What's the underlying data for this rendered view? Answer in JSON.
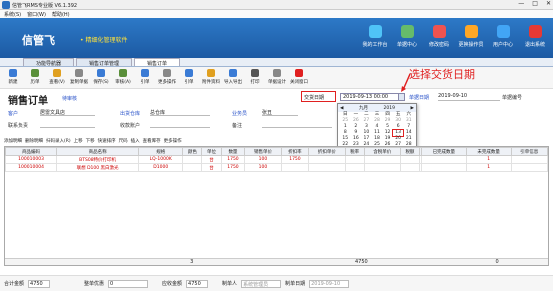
{
  "window": {
    "title": "信管飞RMS专业版 V6.1.392",
    "controls": [
      "—",
      "□",
      "✕"
    ]
  },
  "menu": [
    "系统(S)",
    "窗口(W)",
    "帮助(H)"
  ],
  "banner": {
    "logo": "信管飞",
    "slogan": "• 精细化管理软件",
    "nav": [
      "我的工作台",
      "单据中心",
      "修改密码",
      "更换操作员",
      "用户中心",
      "退出系统"
    ],
    "nav_colors": [
      "#4fc3f7",
      "#66bb6a",
      "#ef5350",
      "#ffa726",
      "#42a5f5",
      "#e53935"
    ]
  },
  "tabs": [
    "功能导航器",
    "销售订单管理",
    "销售订单"
  ],
  "toolbar": [
    "新建",
    "历单",
    "查看(V)",
    "复制单据",
    "保存(S)",
    "审核(A)",
    "引单",
    "更多操作",
    "引单",
    "附件资料",
    "导入导出",
    "打印",
    "单据设计",
    "关闭窗口"
  ],
  "form": {
    "title": "销售订单",
    "status": "待审核",
    "customer_lbl": "客户",
    "customer_val": "居雷文具店",
    "dept_lbl": "出货仓库",
    "dept_val": "总仓库",
    "sales_lbl": "业务员",
    "sales_val": "张丑",
    "contact_lbl": "联系负责",
    "receivable_lbl": "收款账户",
    "note_lbl": "备注",
    "tradedate_lbl": "交货日期",
    "date_val": "2019-09-13 00:00",
    "delivery_lbl": "单据日期",
    "delivery_val": "2019-09-10",
    "orderno_lbl": "单据编号"
  },
  "annotation": "选择交货日期",
  "calendar": {
    "month": "九月",
    "year": "2019",
    "weekdays": [
      "日",
      "一",
      "二",
      "三",
      "四",
      "五",
      "六"
    ],
    "days": [
      "25",
      "26",
      "27",
      "28",
      "29",
      "30",
      "31",
      "1",
      "2",
      "3",
      "4",
      "5",
      "6",
      "7",
      "8",
      "9",
      "10",
      "11",
      "12",
      "13",
      "14",
      "15",
      "16",
      "17",
      "18",
      "19",
      "20",
      "21",
      "22",
      "23",
      "24",
      "25",
      "26",
      "27",
      "28",
      "29",
      "30",
      "1",
      "2",
      "3",
      "4",
      "5"
    ],
    "today_btn": "今天",
    "clear_btn": "清除"
  },
  "grid_toolbar": [
    "添加明细",
    "删除明细",
    "扫码录入(R)",
    "上移",
    "下移",
    "快速排序",
    "尺码",
    "插入",
    "查看库存",
    "更多操作"
  ],
  "grid": {
    "headers": [
      "商品编码",
      "商品名称",
      "规格",
      "颜色",
      "单位",
      "数量",
      "销售单价",
      "折扣率",
      "折扣单价",
      "税率",
      "含税单价",
      "税额",
      "",
      "已完成数量",
      "未完成数量",
      "引单信息"
    ],
    "rows": [
      [
        "100010003",
        "BTS08特价打印机",
        "LQ-1000K",
        "",
        "台",
        "1750",
        "100",
        "1750",
        "",
        "",
        "",
        "",
        "",
        "",
        "1",
        ""
      ],
      [
        "100010004",
        "联想 D100 黑白激光",
        "D1000",
        "",
        "台",
        "1750",
        "100",
        "",
        "",
        "",
        "",
        "",
        "",
        "",
        "1",
        ""
      ]
    ],
    "totals": [
      "",
      "",
      "",
      "",
      "",
      "3",
      "",
      "",
      "",
      "",
      "4750",
      "",
      "",
      "",
      "0",
      ""
    ]
  },
  "footer": {
    "amount_lbl": "合计金额",
    "amount_val": "4750",
    "discount_lbl": "整单优惠",
    "discount_val": "0",
    "receivable_lbl": "应收金额",
    "receivable_val": "4750",
    "maker_lbl": "制单人",
    "maker_val": "系统管理员",
    "make_date_lbl": "制单日期",
    "make_date_val": "2019-09-10"
  }
}
